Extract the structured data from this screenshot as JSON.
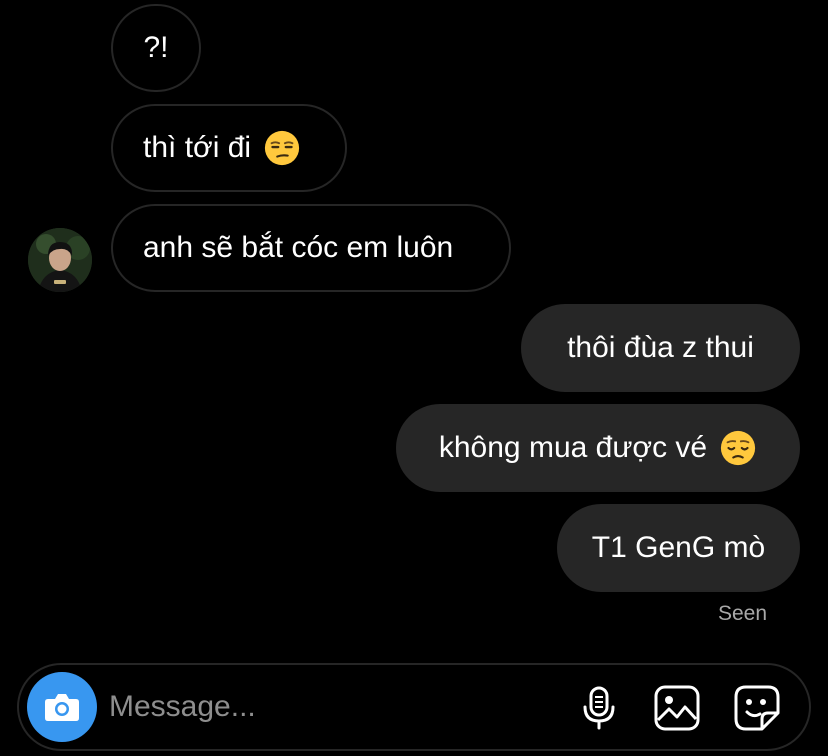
{
  "conversation": {
    "incoming": [
      {
        "text": "?!",
        "emoji": ""
      },
      {
        "text": "thì tới đi",
        "emoji": "unamused-face"
      },
      {
        "text": "anh sẽ bắt cóc em luôn",
        "emoji": ""
      }
    ],
    "outgoing": [
      {
        "text": "thôi đùa z thui",
        "emoji": ""
      },
      {
        "text": "không mua được vé",
        "emoji": "pensive-face"
      },
      {
        "text": "T1 GenG mò",
        "emoji": ""
      }
    ],
    "seen_label": "Seen"
  },
  "composer": {
    "placeholder": "Message...",
    "icons": [
      "camera-icon",
      "microphone-icon",
      "gallery-icon",
      "sticker-icon"
    ]
  },
  "colors": {
    "background": "#000000",
    "outgoing_bubble": "#262626",
    "incoming_border": "#262626",
    "camera_button": "#3897f0",
    "seen_text": "#a8a8a8",
    "placeholder": "#8e8e8e",
    "emoji": "#ffc83d"
  }
}
